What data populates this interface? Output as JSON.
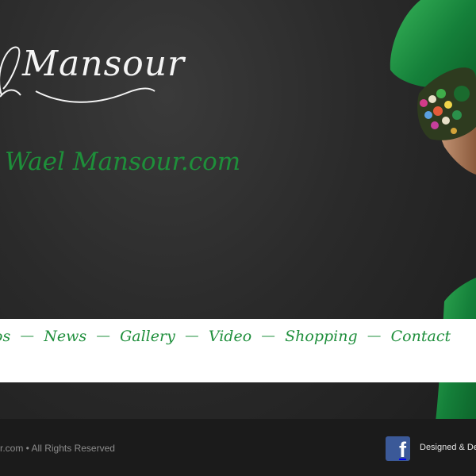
{
  "brand": {
    "script_name": "Mansour",
    "tagline": "Wael Mansour.com"
  },
  "nav": {
    "items": [
      "os",
      "News",
      "Gallery",
      "Video",
      "Shopping",
      "Contact"
    ],
    "separator": "—"
  },
  "footer": {
    "copyright": "r.com • All Rights Reserved",
    "facebook_icon": "f",
    "designed": "Designed & De"
  },
  "colors": {
    "accent_green": "#1f8f3c",
    "background": "#2a2a2a",
    "facebook_blue": "#3b5998"
  },
  "icons": [
    "facebook-icon"
  ]
}
